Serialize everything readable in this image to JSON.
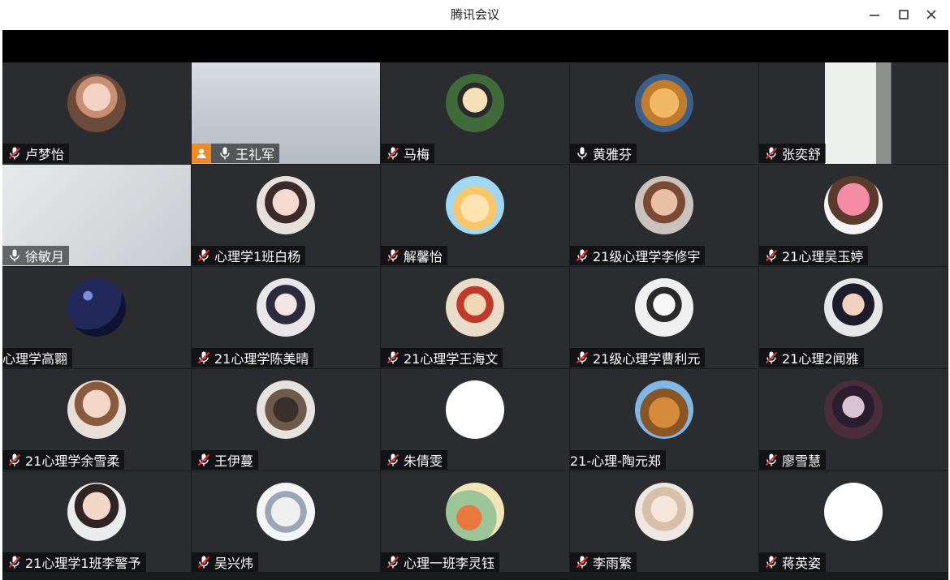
{
  "window": {
    "title": "腾讯会议",
    "controls": [
      "minimize-icon",
      "maximize-icon",
      "close-icon"
    ]
  },
  "colors": {
    "tile_bg": "#2b2c30",
    "active_border": "#29b17a",
    "host_badge": "#f08a24",
    "muted_slash": "#e0303a"
  },
  "participants": [
    {
      "name": "卢梦怡",
      "mic": "muted"
    },
    {
      "name": "王礼军",
      "mic": "on",
      "host": true,
      "video": true,
      "active": true
    },
    {
      "name": "马梅",
      "mic": "muted"
    },
    {
      "name": "黄雅芬",
      "mic": "on"
    },
    {
      "name": "张奕舒",
      "mic": "muted",
      "video": true
    },
    {
      "name": "徐敏月",
      "mic": "on",
      "video": true
    },
    {
      "name": "心理学1班白杨",
      "mic": "muted"
    },
    {
      "name": "解馨怡",
      "mic": "muted"
    },
    {
      "name": "21级心理学李修宇",
      "mic": "muted"
    },
    {
      "name": "21心理吴玉婷",
      "mic": "muted"
    },
    {
      "name": "心理学高翾",
      "mic": "none"
    },
    {
      "name": "21心理学陈美晴",
      "mic": "muted"
    },
    {
      "name": "21心理学王海文",
      "mic": "muted"
    },
    {
      "name": "21级心理学曹利元",
      "mic": "muted"
    },
    {
      "name": "21心理2闻雅",
      "mic": "muted"
    },
    {
      "name": "21心理学余雪柔",
      "mic": "muted"
    },
    {
      "name": "王伊蔓",
      "mic": "muted"
    },
    {
      "name": "朱倩雯",
      "mic": "muted"
    },
    {
      "name": "21-心理-陶元郑",
      "mic": "none"
    },
    {
      "name": "廖雪慧",
      "mic": "muted"
    },
    {
      "name": "21心理学1班李警予",
      "mic": "muted"
    },
    {
      "name": "吴兴炜",
      "mic": "muted"
    },
    {
      "name": "心理一班李灵钰",
      "mic": "muted"
    },
    {
      "name": "李雨繁",
      "mic": "muted"
    },
    {
      "name": "蒋英姿",
      "mic": "muted"
    }
  ]
}
